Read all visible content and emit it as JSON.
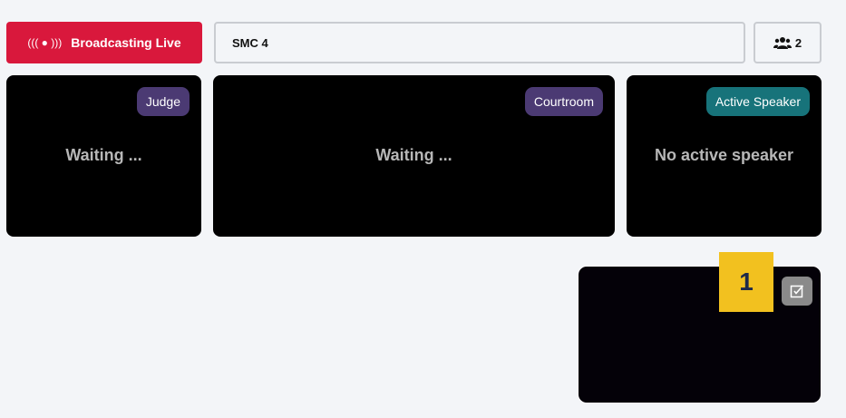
{
  "header": {
    "live_icon_text": "((( ● )))",
    "live_label": "Broadcasting Live",
    "room_name": "SMC 4",
    "participant_count": "2",
    "participant_icon": "users-icon"
  },
  "tiles": [
    {
      "badge": "Judge",
      "status": "Waiting ..."
    },
    {
      "badge": "Courtroom",
      "status": "Waiting ..."
    },
    {
      "badge": "Active Speaker",
      "status": "No active speaker"
    }
  ],
  "self_view": {
    "marker_number": "1",
    "edit_icon": "edit-square-icon"
  },
  "colors": {
    "live": "#d9183c",
    "badge_purple": "#4b3a73",
    "badge_teal": "#17737a",
    "marker": "#f2c11f"
  }
}
